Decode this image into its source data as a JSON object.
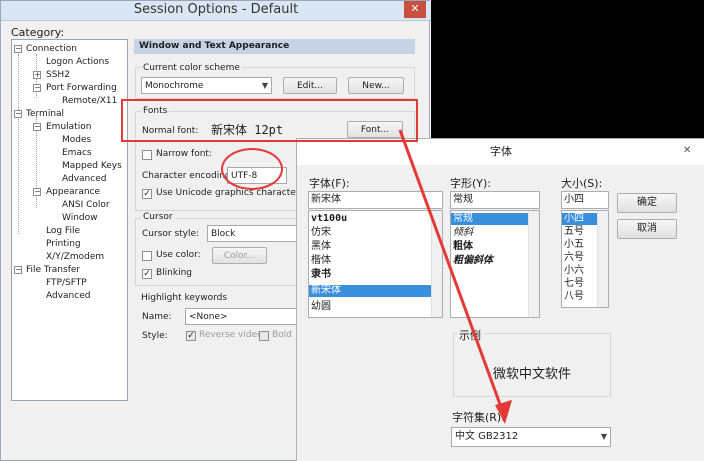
{
  "window": {
    "title": "Session Options - Default",
    "close": "✕",
    "category_label": "Category:"
  },
  "tree": {
    "items": [
      {
        "label": "Connection",
        "pm": "−"
      },
      {
        "label": "Logon Actions"
      },
      {
        "label": "SSH2",
        "pm": "+"
      },
      {
        "label": "Port Forwarding",
        "pm": "−"
      },
      {
        "label": "Remote/X11"
      },
      {
        "label": "Terminal",
        "pm": "−"
      },
      {
        "label": "Emulation",
        "pm": "−"
      },
      {
        "label": "Modes"
      },
      {
        "label": "Emacs"
      },
      {
        "label": "Mapped Keys"
      },
      {
        "label": "Advanced"
      },
      {
        "label": "Appearance",
        "pm": "−"
      },
      {
        "label": "ANSI Color"
      },
      {
        "label": "Window"
      },
      {
        "label": "Log File"
      },
      {
        "label": "Printing"
      },
      {
        "label": "X/Y/Zmodem"
      },
      {
        "label": "File Transfer",
        "pm": "−"
      },
      {
        "label": "FTP/SFTP"
      },
      {
        "label": "Advanced"
      }
    ]
  },
  "panel": {
    "header": "Window and Text Appearance",
    "color_scheme_label": "Current color scheme",
    "color_scheme_value": "Monochrome",
    "edit_button": "Edit...",
    "new_button": "New...",
    "fonts_label": "Fonts",
    "normal_font_label": "Normal font:",
    "normal_font_value": "新宋体  12pt",
    "font_button": "Font...",
    "narrow_font_label": "Narrow font:",
    "char_encoding_label": "Character encoding:",
    "char_encoding_value": "UTF-8",
    "unicode_graphics_label": "Use Unicode graphics characters",
    "cursor_label": "Cursor",
    "cursor_style_label": "Cursor style:",
    "cursor_style_value": "Block",
    "use_color_label": "Use color:",
    "color_button": "Color...",
    "blinking_label": "Blinking",
    "highlight_label": "Highlight keywords",
    "name_label": "Name:",
    "name_value": "<None>",
    "style_label": "Style:",
    "reverse_video_label": "Reverse video",
    "bold_label": "Bold"
  },
  "font_dialog": {
    "title": "字体",
    "close": "✕",
    "font_label": "字体(F):",
    "font_value": "新宋体",
    "fonts": [
      "vt100u",
      "仿宋",
      "黑体",
      "楷体",
      "隶书",
      "新宋体",
      "幼圆"
    ],
    "style_label": "字形(Y):",
    "style_value": "常规",
    "styles": [
      "常规",
      "倾斜",
      "粗体",
      "粗偏斜体"
    ],
    "size_label": "大小(S):",
    "size_value": "小四",
    "sizes": [
      "小四",
      "五号",
      "小五",
      "六号",
      "小六",
      "七号",
      "八号"
    ],
    "ok_button": "确定",
    "cancel_button": "取消",
    "sample_label": "示例",
    "sample_text": "微软中文软件",
    "charset_label": "字符集(R):",
    "charset_value": "中文 GB2312"
  },
  "colors": {
    "annotation_red": "#e53935",
    "selection_blue": "#3a8fdc",
    "header_blue": "#c5d3e4"
  }
}
